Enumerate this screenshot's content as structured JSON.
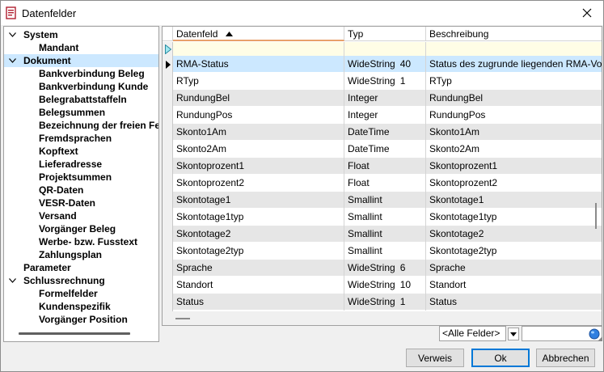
{
  "window": {
    "title": "Datenfelder"
  },
  "tree": {
    "nodes": [
      {
        "label": "System",
        "level": 0,
        "expanded": true,
        "selected": false
      },
      {
        "label": "Mandant",
        "level": 1,
        "selected": false
      },
      {
        "label": "Dokument",
        "level": 0,
        "expanded": true,
        "selected": true
      },
      {
        "label": "Bankverbindung Beleg",
        "level": 1,
        "selected": false
      },
      {
        "label": "Bankverbindung Kunde",
        "level": 1,
        "selected": false
      },
      {
        "label": "Belegrabattstaffeln",
        "level": 1,
        "selected": false
      },
      {
        "label": "Belegsummen",
        "level": 1,
        "selected": false
      },
      {
        "label": "Bezeichnung der freien Felder",
        "level": 1,
        "selected": false
      },
      {
        "label": "Fremdsprachen",
        "level": 1,
        "selected": false
      },
      {
        "label": "Kopftext",
        "level": 1,
        "selected": false
      },
      {
        "label": "Lieferadresse",
        "level": 1,
        "selected": false
      },
      {
        "label": "Projektsummen",
        "level": 1,
        "selected": false
      },
      {
        "label": "QR-Daten",
        "level": 1,
        "selected": false
      },
      {
        "label": "VESR-Daten",
        "level": 1,
        "selected": false
      },
      {
        "label": "Versand",
        "level": 1,
        "selected": false
      },
      {
        "label": "Vorgänger Beleg",
        "level": 1,
        "selected": false
      },
      {
        "label": "Werbe- bzw. Fusstext",
        "level": 1,
        "selected": false
      },
      {
        "label": "Zahlungsplan",
        "level": 1,
        "selected": false
      },
      {
        "label": "Parameter",
        "level": 0,
        "expanded": false,
        "leaf": true,
        "selected": false
      },
      {
        "label": "Schlussrechnung",
        "level": 0,
        "expanded": true,
        "selected": false
      },
      {
        "label": "Formelfelder",
        "level": 1,
        "selected": false
      },
      {
        "label": "Kundenspezifik",
        "level": 1,
        "selected": false
      },
      {
        "label": "Vorgänger Position",
        "level": 1,
        "selected": false
      }
    ]
  },
  "grid": {
    "columns": [
      {
        "label": "Datenfeld",
        "sorted": "asc"
      },
      {
        "label": "Typ"
      },
      {
        "label": "Beschreibung"
      }
    ],
    "rows": [
      {
        "field": "RMA-Status",
        "type": "WideString",
        "size": "40",
        "desc": "Status des zugrunde liegenden RMA-Vorgangs",
        "selected": true
      },
      {
        "field": "RTyp",
        "type": "WideString",
        "size": "1",
        "desc": "RTyp"
      },
      {
        "field": "RundungBel",
        "type": "Integer",
        "size": "",
        "desc": "RundungBel"
      },
      {
        "field": "RundungPos",
        "type": "Integer",
        "size": "",
        "desc": "RundungPos"
      },
      {
        "field": "Skonto1Am",
        "type": "DateTime",
        "size": "",
        "desc": "Skonto1Am"
      },
      {
        "field": "Skonto2Am",
        "type": "DateTime",
        "size": "",
        "desc": "Skonto2Am"
      },
      {
        "field": "Skontoprozent1",
        "type": "Float",
        "size": "",
        "desc": "Skontoprozent1"
      },
      {
        "field": "Skontoprozent2",
        "type": "Float",
        "size": "",
        "desc": "Skontoprozent2"
      },
      {
        "field": "Skontotage1",
        "type": "Smallint",
        "size": "",
        "desc": "Skontotage1"
      },
      {
        "field": "Skontotage1typ",
        "type": "Smallint",
        "size": "",
        "desc": "Skontotage1typ"
      },
      {
        "field": "Skontotage2",
        "type": "Smallint",
        "size": "",
        "desc": "Skontotage2"
      },
      {
        "field": "Skontotage2typ",
        "type": "Smallint",
        "size": "",
        "desc": "Skontotage2typ"
      },
      {
        "field": "Sprache",
        "type": "WideString",
        "size": "6",
        "desc": "Sprache"
      },
      {
        "field": "Standort",
        "type": "WideString",
        "size": "10",
        "desc": "Standort"
      },
      {
        "field": "Status",
        "type": "WideString",
        "size": "1",
        "desc": "Status"
      }
    ]
  },
  "filter": {
    "combo_value": "<Alle Felder>",
    "search_value": ""
  },
  "buttons": {
    "verweis": "Verweis",
    "ok": "Ok",
    "abbrechen": "Abbrechen"
  },
  "icons": {
    "close": "close-icon",
    "app": "app-icon",
    "globe": "globe-icon"
  },
  "colors": {
    "selection": "#cce8ff",
    "alt_row": "#e6e6e6",
    "new_row": "#fffde6",
    "accent": "#0078d7"
  }
}
